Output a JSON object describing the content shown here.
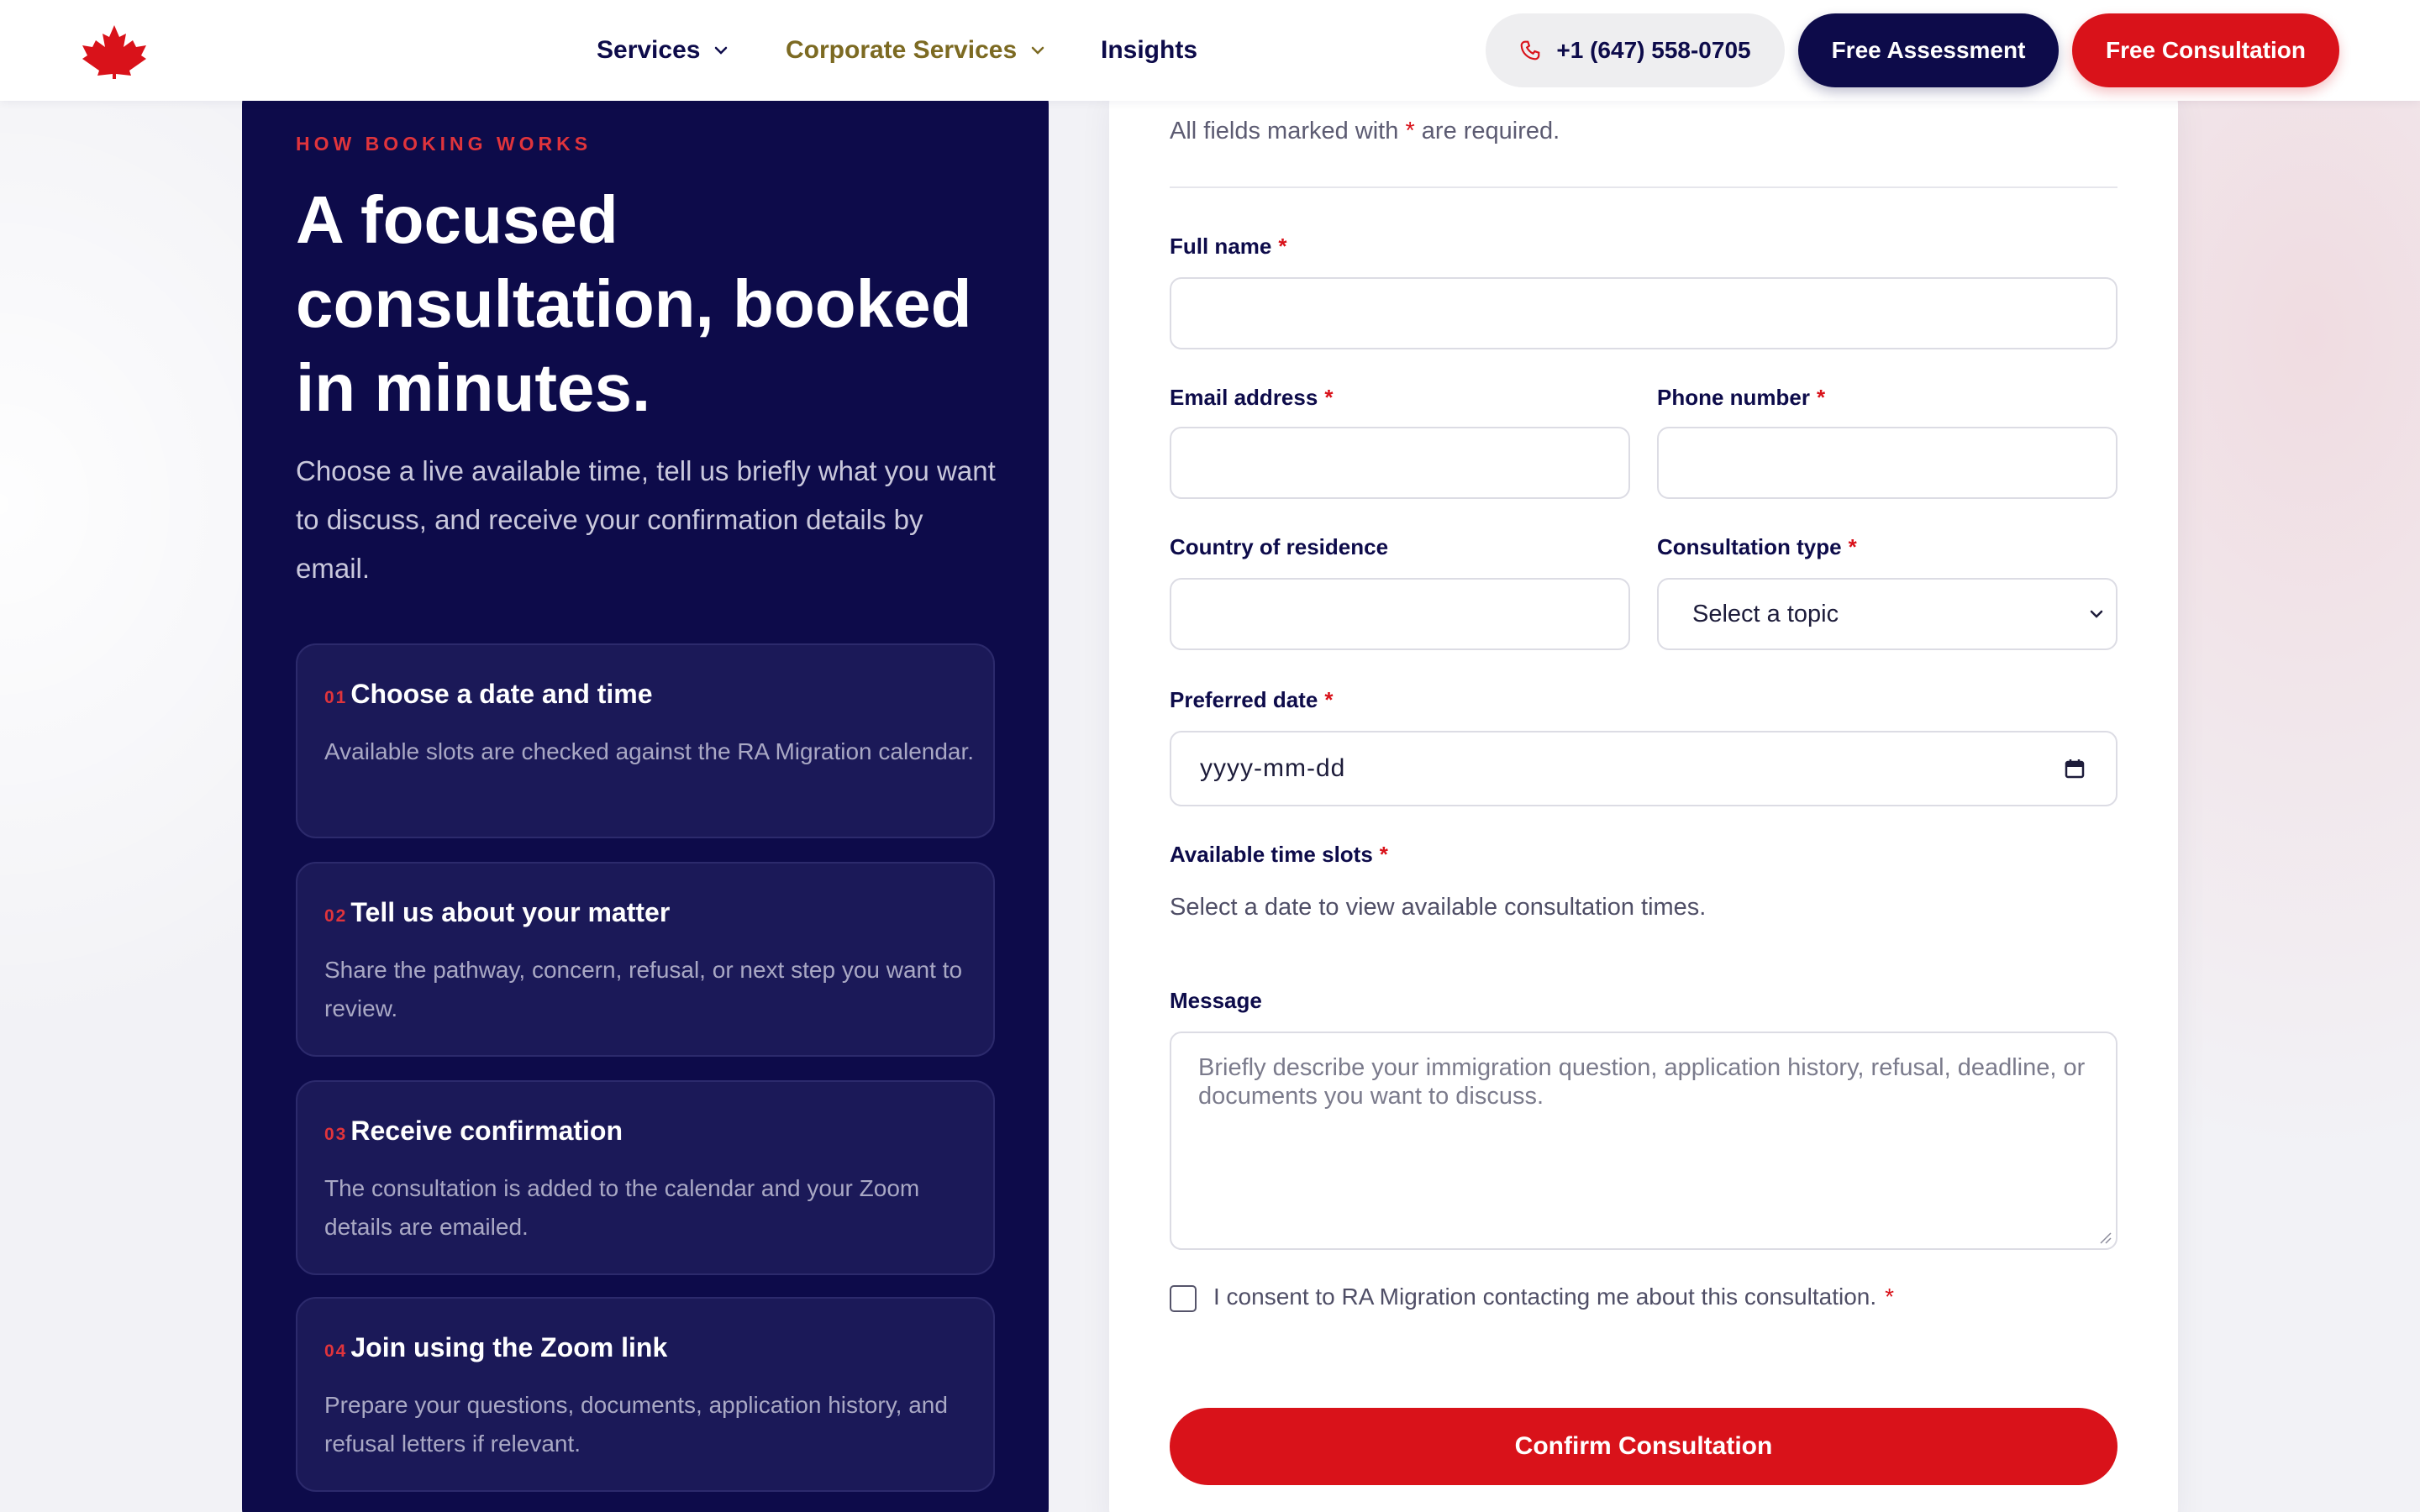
{
  "colors": {
    "navy": "#0d0b4a",
    "red": "#d9121a",
    "gold": "#7c6a22",
    "step_bg": "#1b1958"
  },
  "header": {
    "logo_icon": "maple-leaf-icon",
    "nav": [
      {
        "label": "Services",
        "has_dropdown": true
      },
      {
        "label": "Corporate Services",
        "has_dropdown": true
      },
      {
        "label": "Insights",
        "has_dropdown": false
      }
    ],
    "phone": "+1 (647) 558-0705",
    "assessment_label": "Free Assessment",
    "consultation_label": "Free Consultation"
  },
  "left": {
    "eyebrow": "HOW BOOKING WORKS",
    "title": "A focused consultation, booked in minutes.",
    "subtitle": "Choose a live available time, tell us briefly what you want to discuss, and receive your confirmation details by email.",
    "steps": [
      {
        "num": "01",
        "title": "Choose a date and time",
        "desc": "Available slots are checked against the RA Migration calendar."
      },
      {
        "num": "02",
        "title": "Tell us about your matter",
        "desc": "Share the pathway, concern, refusal, or next step you want to review."
      },
      {
        "num": "03",
        "title": "Receive confirmation",
        "desc": "The consultation is added to the calendar and your Zoom details are emailed."
      },
      {
        "num": "04",
        "title": "Join using the Zoom link",
        "desc": "Prepare your questions, documents, application history, and refusal letters if relevant."
      }
    ]
  },
  "form": {
    "required_note_pre": "All fields marked with",
    "required_star": "*",
    "required_note_post": "are required.",
    "full_name_label": "Full name",
    "full_name_value": "",
    "email_label": "Email address",
    "email_value": "",
    "phone_label": "Phone number",
    "phone_value": "",
    "country_label": "Country of residence",
    "country_value": "",
    "type_label": "Consultation type",
    "type_selected": "Select a topic",
    "date_label": "Preferred date",
    "date_placeholder": "yyyy-mm-dd",
    "slots_label": "Available time slots",
    "slots_helper": "Select a date to view available consultation times.",
    "message_label": "Message",
    "message_placeholder": "Briefly describe your immigration question, application history, refusal, deadline, or documents you want to discuss.",
    "consent_text": "I consent to RA Migration contacting me about this consultation.",
    "submit_label": "Confirm Consultation"
  }
}
